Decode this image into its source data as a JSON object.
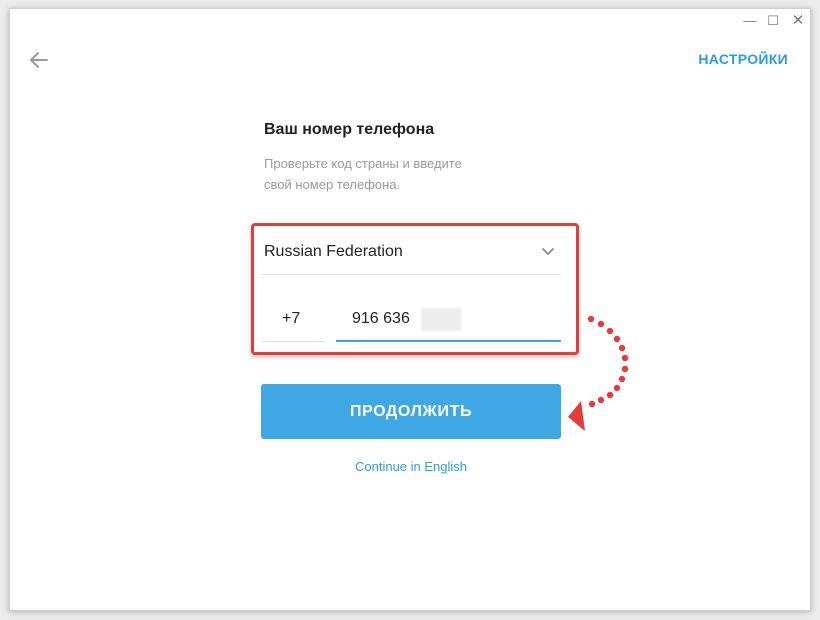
{
  "window": {
    "controls": {
      "minimize": "—",
      "maximize": "☐",
      "close": "✕"
    }
  },
  "header": {
    "back_icon": "arrow-left-icon",
    "settings_label": "НАСТРОЙКИ"
  },
  "form": {
    "title": "Ваш номер телефона",
    "subtitle_line1": "Проверьте код страны и введите",
    "subtitle_line2": "свой номер телефона.",
    "country": "Russian Federation",
    "country_code": "+7",
    "phone_number": "916 636"
  },
  "actions": {
    "continue_label": "ПРОДОЛЖИТЬ",
    "english_link": "Continue in English"
  },
  "colors": {
    "accent": "#3fa7e3",
    "link": "#2a9de4",
    "annotation_red": "#e23c3c"
  }
}
